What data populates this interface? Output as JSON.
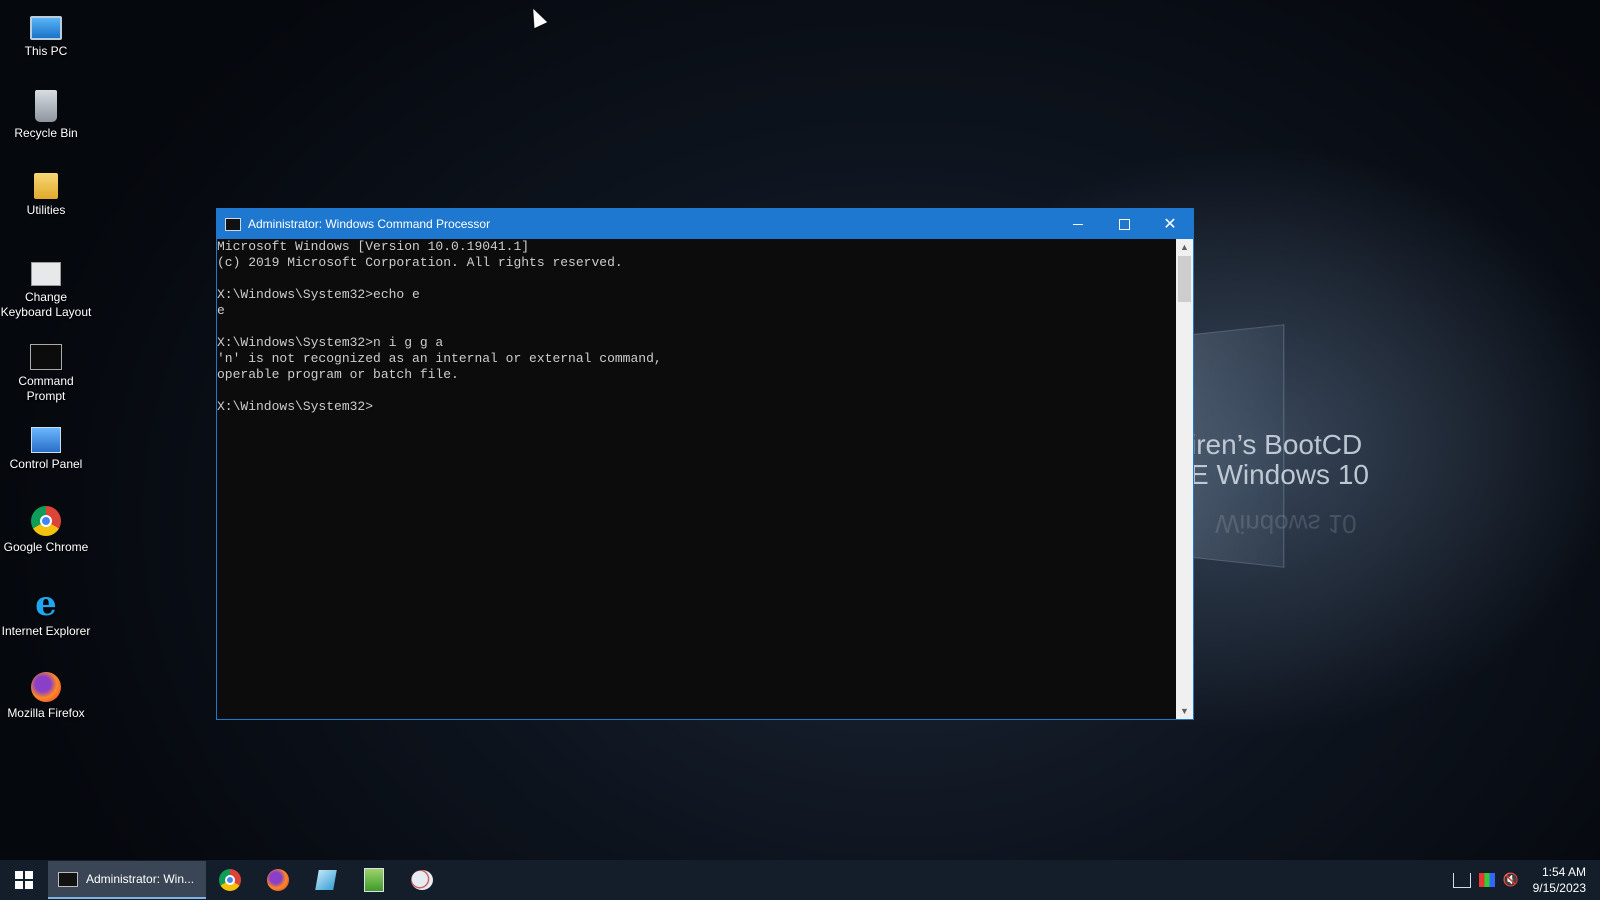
{
  "desktop": {
    "icons": [
      {
        "label": "This PC",
        "icon": "computer-icon"
      },
      {
        "label": "Recycle Bin",
        "icon": "recycle-bin-icon"
      },
      {
        "label": "Utilities",
        "icon": "folder-icon"
      },
      {
        "label": "Change Keyboard Layout",
        "icon": "keyboard-icon"
      },
      {
        "label": "Command Prompt",
        "icon": "command-prompt-icon"
      },
      {
        "label": "Control Panel",
        "icon": "control-panel-icon"
      },
      {
        "label": "Google Chrome",
        "icon": "chrome-icon"
      },
      {
        "label": "Internet Explorer",
        "icon": "internet-explorer-icon"
      },
      {
        "label": "Mozilla Firefox",
        "icon": "firefox-icon"
      }
    ],
    "watermark_line1": "iren’s BootCD",
    "watermark_line2": "E Windows 10",
    "watermark_reflection": "Windows 10"
  },
  "window": {
    "title": "Administrator: Windows Command Processor",
    "console_lines": [
      "Microsoft Windows [Version 10.0.19041.1]",
      "(c) 2019 Microsoft Corporation. All rights reserved.",
      "",
      "X:\\Windows\\System32>echo e",
      "e",
      "",
      "X:\\Windows\\System32>n i g g a",
      "'n' is not recognized as an internal or external command,",
      "operable program or batch file.",
      "",
      "X:\\Windows\\System32>"
    ],
    "scroll_up_glyph": "▲",
    "scroll_down_glyph": "▼",
    "close_glyph": "✕"
  },
  "taskbar": {
    "active_task_label": "Administrator: Win...",
    "pinned": [
      "chrome-icon",
      "firefox-icon",
      "explorer-icon",
      "notepad-icon",
      "paint-icon"
    ],
    "tray": {
      "volume_glyph": "🔇",
      "time": "1:54 AM",
      "date": "9/15/2023"
    }
  }
}
